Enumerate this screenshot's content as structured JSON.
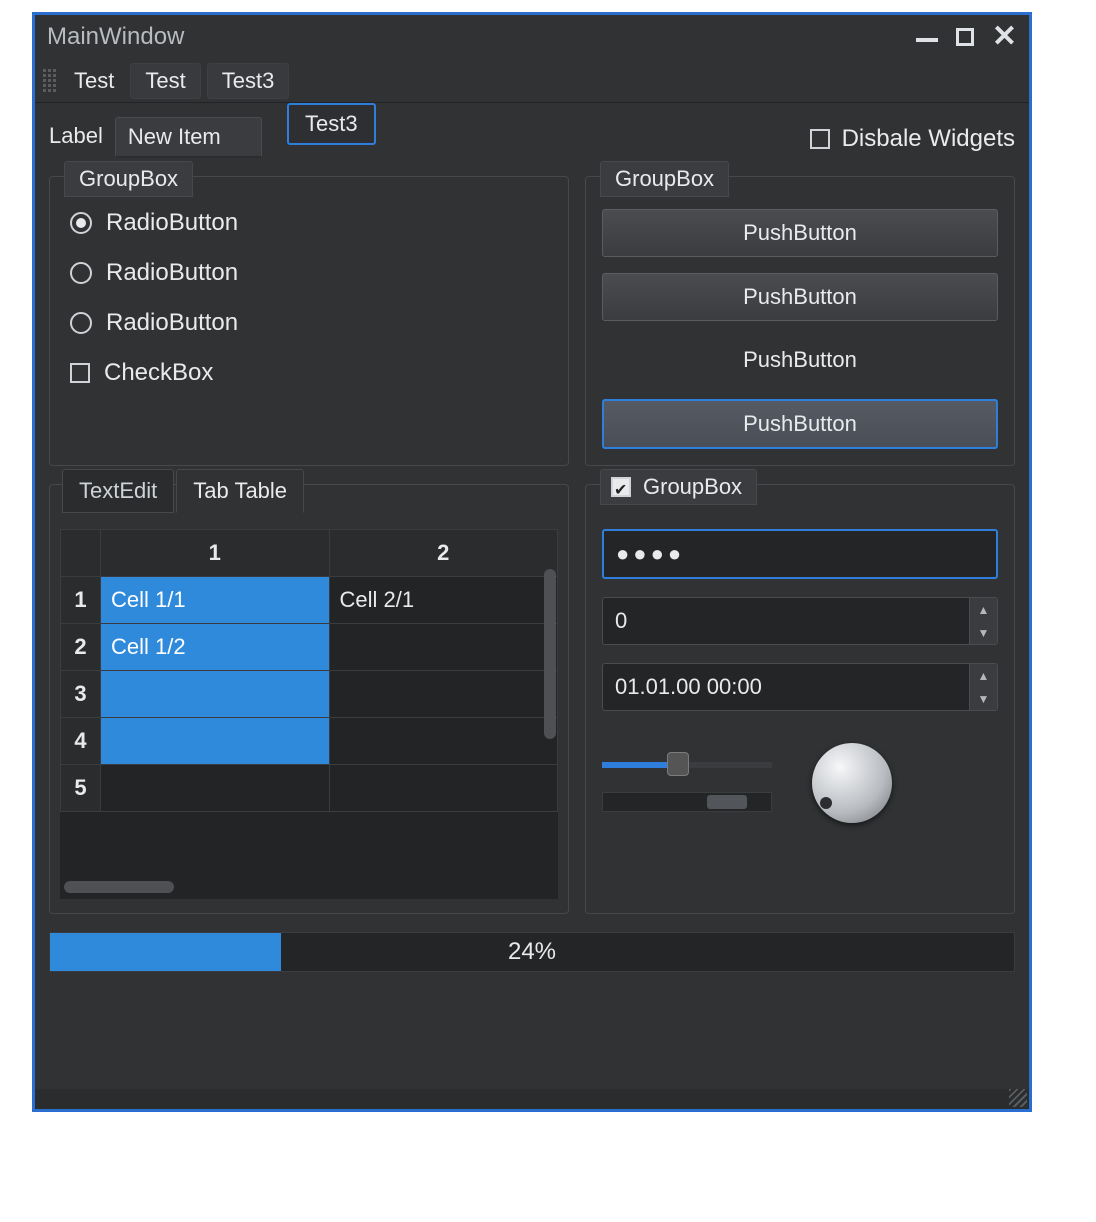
{
  "window": {
    "title": "MainWindow"
  },
  "menubar": {
    "items": [
      "Test",
      "Test",
      "Test3"
    ]
  },
  "row1": {
    "label": "Label",
    "combo_value": "New Item",
    "floating_tab": "Test3",
    "disable_label": "Disbale Widgets",
    "disable_checked": false
  },
  "group_radio": {
    "title": "GroupBox",
    "radios": [
      "RadioButton",
      "RadioButton",
      "RadioButton"
    ],
    "radio_selected_index": 0,
    "checkbox_label": "CheckBox",
    "checkbox_checked": false
  },
  "group_buttons": {
    "title": "GroupBox",
    "buttons": [
      "PushButton",
      "PushButton",
      "PushButton",
      "PushButton"
    ],
    "flat_index": 2,
    "focus_index": 3
  },
  "tabs": {
    "items": [
      "TextEdit",
      "Tab Table"
    ],
    "active_index": 1,
    "table": {
      "col_headers": [
        "1",
        "2"
      ],
      "row_headers": [
        "1",
        "2",
        "3",
        "4",
        "5"
      ],
      "cells": {
        "r1c1": "Cell 1/1",
        "r1c2": "Cell 2/1",
        "r2c1": "Cell 1/2",
        "r2c2": "",
        "r3c1": "",
        "r3c2": "",
        "r4c1": "",
        "r4c2": "",
        "r5c1": "",
        "r5c2": ""
      },
      "selected": [
        "r1c1",
        "r2c1",
        "r3c1",
        "r4c1"
      ]
    }
  },
  "group_inputs": {
    "title": "GroupBox",
    "checkable": true,
    "checked": true,
    "password_display": "●●●●",
    "spin_value": "0",
    "datetime_value": "01.01.00 00:00",
    "slider_percent": 40
  },
  "progress": {
    "value": 24,
    "label": "24%"
  },
  "colors": {
    "accent": "#2f7edb",
    "selection": "#2f8adb",
    "bg": "#303234"
  }
}
